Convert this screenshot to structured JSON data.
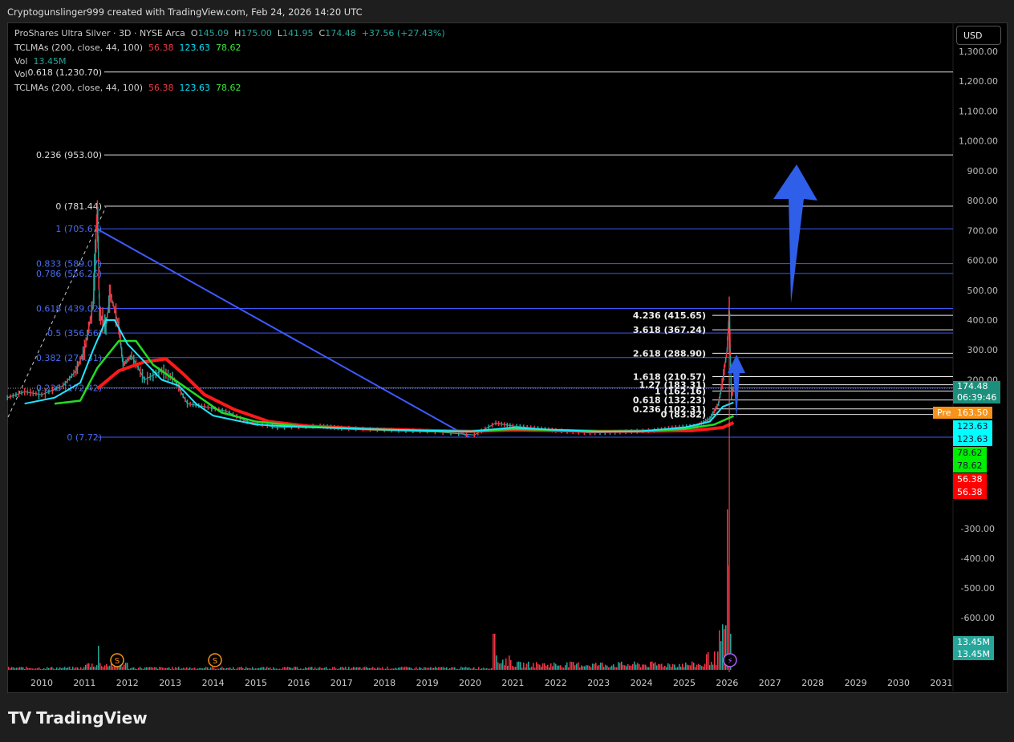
{
  "header": {
    "caption": "Cryptogunslinger999 created with TradingView.com, Feb 24, 2026 14:20 UTC"
  },
  "legend": {
    "symbol": "ProShares Ultra Silver · 3D · NYSE Arca",
    "o_label": "O",
    "o": "145.09",
    "h_label": "H",
    "h": "175.00",
    "l_label": "L",
    "l": "141.95",
    "c_label": "C",
    "c": "174.48",
    "change": "+37.56 (+27.43%)",
    "ma_label": "TCLMAs (200, close, 44, 100)",
    "ma_red": "56.38",
    "ma_cyan": "123.63",
    "ma_green": "78.62",
    "vol_label": "Vol",
    "vol": "13.45M"
  },
  "currency": "USD",
  "brand": "TradingView",
  "tags": {
    "price": "174.48",
    "countdown": "06:39:46",
    "pre_label": "Pre",
    "pre": "163.50",
    "cyan": "123.63",
    "green": "78.62",
    "red": "56.38",
    "vol": "13.45M"
  },
  "colors": {
    "up": "#26a69a",
    "down": "#f23645",
    "fib_blue": "#3d5afe",
    "ma_red": "#ff1a1a",
    "ma_cyan": "#22e5ff",
    "ma_green": "#22dd22",
    "arrow": "#2f5ee8"
  },
  "chart_data": {
    "type": "line",
    "title": "ProShares Ultra Silver · 3D · NYSE Arca",
    "y_ticks": [
      "1,300.00",
      "1,200.00",
      "1,100.00",
      "1,000.00",
      "900.00",
      "800.00",
      "700.00",
      "600.00",
      "500.00",
      "400.00",
      "300.00",
      "200.00"
    ],
    "vol_ticks": [
      "-300.00",
      "-400.00",
      "-500.00",
      "-600.00"
    ],
    "x_ticks": [
      "2010",
      "2011",
      "2012",
      "2013",
      "2014",
      "2015",
      "2016",
      "2017",
      "2018",
      "2019",
      "2020",
      "2021",
      "2022",
      "2023",
      "2024",
      "2025",
      "2026",
      "2027",
      "2028",
      "2029",
      "2030",
      "2031"
    ],
    "ylim": [
      0,
      1300
    ],
    "price": [
      [
        2009.2,
        140
      ],
      [
        2009.6,
        160
      ],
      [
        2010,
        150
      ],
      [
        2010.5,
        180
      ],
      [
        2010.8,
        230
      ],
      [
        2011.0,
        300
      ],
      [
        2011.2,
        450
      ],
      [
        2011.3,
        781
      ],
      [
        2011.35,
        420
      ],
      [
        2011.5,
        380
      ],
      [
        2011.6,
        490
      ],
      [
        2011.8,
        380
      ],
      [
        2011.9,
        250
      ],
      [
        2012.1,
        280
      ],
      [
        2012.4,
        200
      ],
      [
        2012.8,
        230
      ],
      [
        2013.1,
        200
      ],
      [
        2013.4,
        120
      ],
      [
        2013.8,
        110
      ],
      [
        2014.3,
        95
      ],
      [
        2014.8,
        60
      ],
      [
        2015.5,
        40
      ],
      [
        2016.5,
        45
      ],
      [
        2017,
        38
      ],
      [
        2018,
        32
      ],
      [
        2019,
        28
      ],
      [
        2020.1,
        15
      ],
      [
        2020.6,
        55
      ],
      [
        2021,
        45
      ],
      [
        2021.5,
        38
      ],
      [
        2022,
        30
      ],
      [
        2022.8,
        22
      ],
      [
        2023.5,
        25
      ],
      [
        2024.3,
        30
      ],
      [
        2024.8,
        40
      ],
      [
        2025.3,
        45
      ],
      [
        2025.6,
        70
      ],
      [
        2025.8,
        120
      ],
      [
        2025.9,
        200
      ],
      [
        2026.0,
        300
      ],
      [
        2026.05,
        430
      ],
      [
        2026.1,
        150
      ],
      [
        2026.15,
        174
      ]
    ],
    "ma_cyan": [
      [
        2009.6,
        120
      ],
      [
        2010.3,
        140
      ],
      [
        2010.9,
        190
      ],
      [
        2011.2,
        300
      ],
      [
        2011.5,
        400
      ],
      [
        2011.7,
        400
      ],
      [
        2012,
        320
      ],
      [
        2012.4,
        260
      ],
      [
        2012.8,
        200
      ],
      [
        2013.2,
        180
      ],
      [
        2013.6,
        120
      ],
      [
        2014,
        80
      ],
      [
        2015,
        50
      ],
      [
        2016,
        42
      ],
      [
        2017,
        38
      ],
      [
        2018,
        33
      ],
      [
        2019,
        30
      ],
      [
        2020,
        27
      ],
      [
        2021,
        40
      ],
      [
        2022,
        32
      ],
      [
        2023,
        26
      ],
      [
        2024,
        28
      ],
      [
        2025,
        40
      ],
      [
        2025.6,
        60
      ],
      [
        2025.9,
        110
      ],
      [
        2026.15,
        123.63
      ]
    ],
    "ma_green": [
      [
        2010.3,
        120
      ],
      [
        2010.9,
        130
      ],
      [
        2011.3,
        240
      ],
      [
        2011.8,
        330
      ],
      [
        2012.2,
        330
      ],
      [
        2012.6,
        250
      ],
      [
        2013.1,
        200
      ],
      [
        2013.6,
        150
      ],
      [
        2014.2,
        90
      ],
      [
        2015,
        60
      ],
      [
        2016,
        45
      ],
      [
        2017,
        38
      ],
      [
        2018,
        33
      ],
      [
        2019,
        28
      ],
      [
        2020,
        27
      ],
      [
        2021,
        35
      ],
      [
        2022,
        32
      ],
      [
        2023,
        27
      ],
      [
        2024,
        28
      ],
      [
        2025,
        35
      ],
      [
        2025.7,
        50
      ],
      [
        2026.15,
        78.62
      ]
    ],
    "ma_red": [
      [
        2011.3,
        170
      ],
      [
        2011.8,
        230
      ],
      [
        2012.4,
        260
      ],
      [
        2012.9,
        270
      ],
      [
        2013.3,
        220
      ],
      [
        2013.8,
        150
      ],
      [
        2014.5,
        100
      ],
      [
        2015.3,
        60
      ],
      [
        2016.2,
        45
      ],
      [
        2017.5,
        36
      ],
      [
        2019,
        30
      ],
      [
        2020,
        27
      ],
      [
        2021,
        32
      ],
      [
        2022,
        30
      ],
      [
        2023,
        27
      ],
      [
        2024,
        28
      ],
      [
        2025.2,
        30
      ],
      [
        2025.9,
        40
      ],
      [
        2026.15,
        56.38
      ]
    ],
    "fib_left": [
      {
        "label": "0.618 (1,230.70)",
        "price": 1230.7,
        "color": "white"
      },
      {
        "label": "0.236 (953.00)",
        "price": 953,
        "color": "white"
      },
      {
        "label": "0 (781.44)",
        "price": 781.44,
        "color": "white"
      },
      {
        "label": "1 (705.61)",
        "price": 705.61,
        "color": "blue"
      },
      {
        "label": "0.833 (589.07)",
        "price": 589.07,
        "color": "blue"
      },
      {
        "label": "0.786 (556.26)",
        "price": 556.26,
        "color": "blue"
      },
      {
        "label": "0.618 (439.02)",
        "price": 439.02,
        "color": "blue"
      },
      {
        "label": "0.5 (356.66)",
        "price": 356.66,
        "color": "blue"
      },
      {
        "label": "0.382 (274.31)",
        "price": 274.31,
        "color": "blue"
      },
      {
        "label": "0.236 (172.42)",
        "price": 172.42,
        "color": "blue"
      },
      {
        "label": "0 (7.72)",
        "price": 7.72,
        "color": "blue"
      }
    ],
    "fib_right": [
      {
        "label": "4.236 (415.65)",
        "price": 415.65
      },
      {
        "label": "3.618 (367.24)",
        "price": 367.24
      },
      {
        "label": "2.618 (288.90)",
        "price": 288.9
      },
      {
        "label": "1.618 (210.57)",
        "price": 210.57
      },
      {
        "label": "1.27 (183.31)",
        "price": 183.31
      },
      {
        "label": "1 (162.16)",
        "price": 162.16
      },
      {
        "label": "0.618 (132.23)",
        "price": 132.23
      },
      {
        "label": "0.236 (102.31)",
        "price": 102.31
      },
      {
        "label": "0 (83.82)",
        "price": 83.82
      }
    ]
  }
}
